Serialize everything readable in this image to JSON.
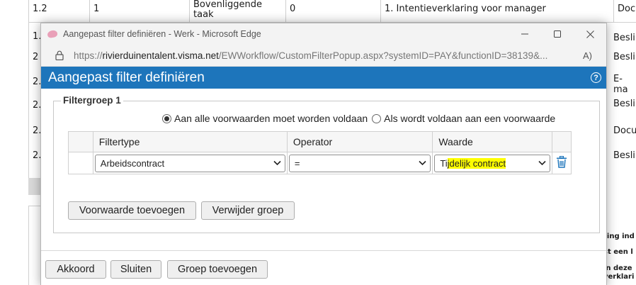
{
  "background": {
    "rows": [
      {
        "num": "1.2",
        "col2": "1",
        "col3": "Bovenliggende taak",
        "col4": "0",
        "col5": "1. Intentieverklaring voor manager",
        "col6": "Docu"
      },
      {
        "num": "1.",
        "col6": "Besli"
      },
      {
        "num": "2",
        "col6": "Besli"
      },
      {
        "num": "2.",
        "col6": "E-ma"
      },
      {
        "num": "2.",
        "col6": "Besli"
      },
      {
        "num": "2.",
        "col6": "Docu"
      },
      {
        "num": "2.",
        "col6": "Besli"
      }
    ],
    "side_snippets": [
      "ring ind",
      "st een l",
      "in deze",
      "verklari"
    ]
  },
  "window": {
    "title": "Aangepast filter definiëren - Werk - Microsoft Edge",
    "url_prefix": "https://",
    "url_host": "rivierduinentalent.visma.net",
    "url_path": "/EWWorkflow/CustomFilterPopup.aspx?systemID=PAY&functionID=38139&...",
    "read_aloud": "A)"
  },
  "dialog": {
    "title": "Aangepast filter definiëren",
    "help": "?",
    "group": {
      "legend": "Filtergroep 1",
      "radio_all": "Aan alle voorwaarden moet worden voldaan",
      "radio_any": "Als wordt voldaan aan een voorwaarde",
      "columns": {
        "filtertype": "Filtertype",
        "operator": "Operator",
        "waarde": "Waarde"
      },
      "row": {
        "filtertype": "Arbeidscontract",
        "operator": "=",
        "waarde_pre": "Ti",
        "waarde_hl": "jdelijk contract",
        "waarde_post": "  "
      },
      "add_condition": "Voorwaarde toevoegen",
      "remove_group": "Verwijder groep"
    },
    "footer": {
      "accept": "Akkoord",
      "close": "Sluiten",
      "add_group": "Groep toevoegen"
    }
  },
  "colors": {
    "header_blue": "#1d75bb",
    "highlight": "#ffff00",
    "trash_blue": "#1d75bb"
  }
}
